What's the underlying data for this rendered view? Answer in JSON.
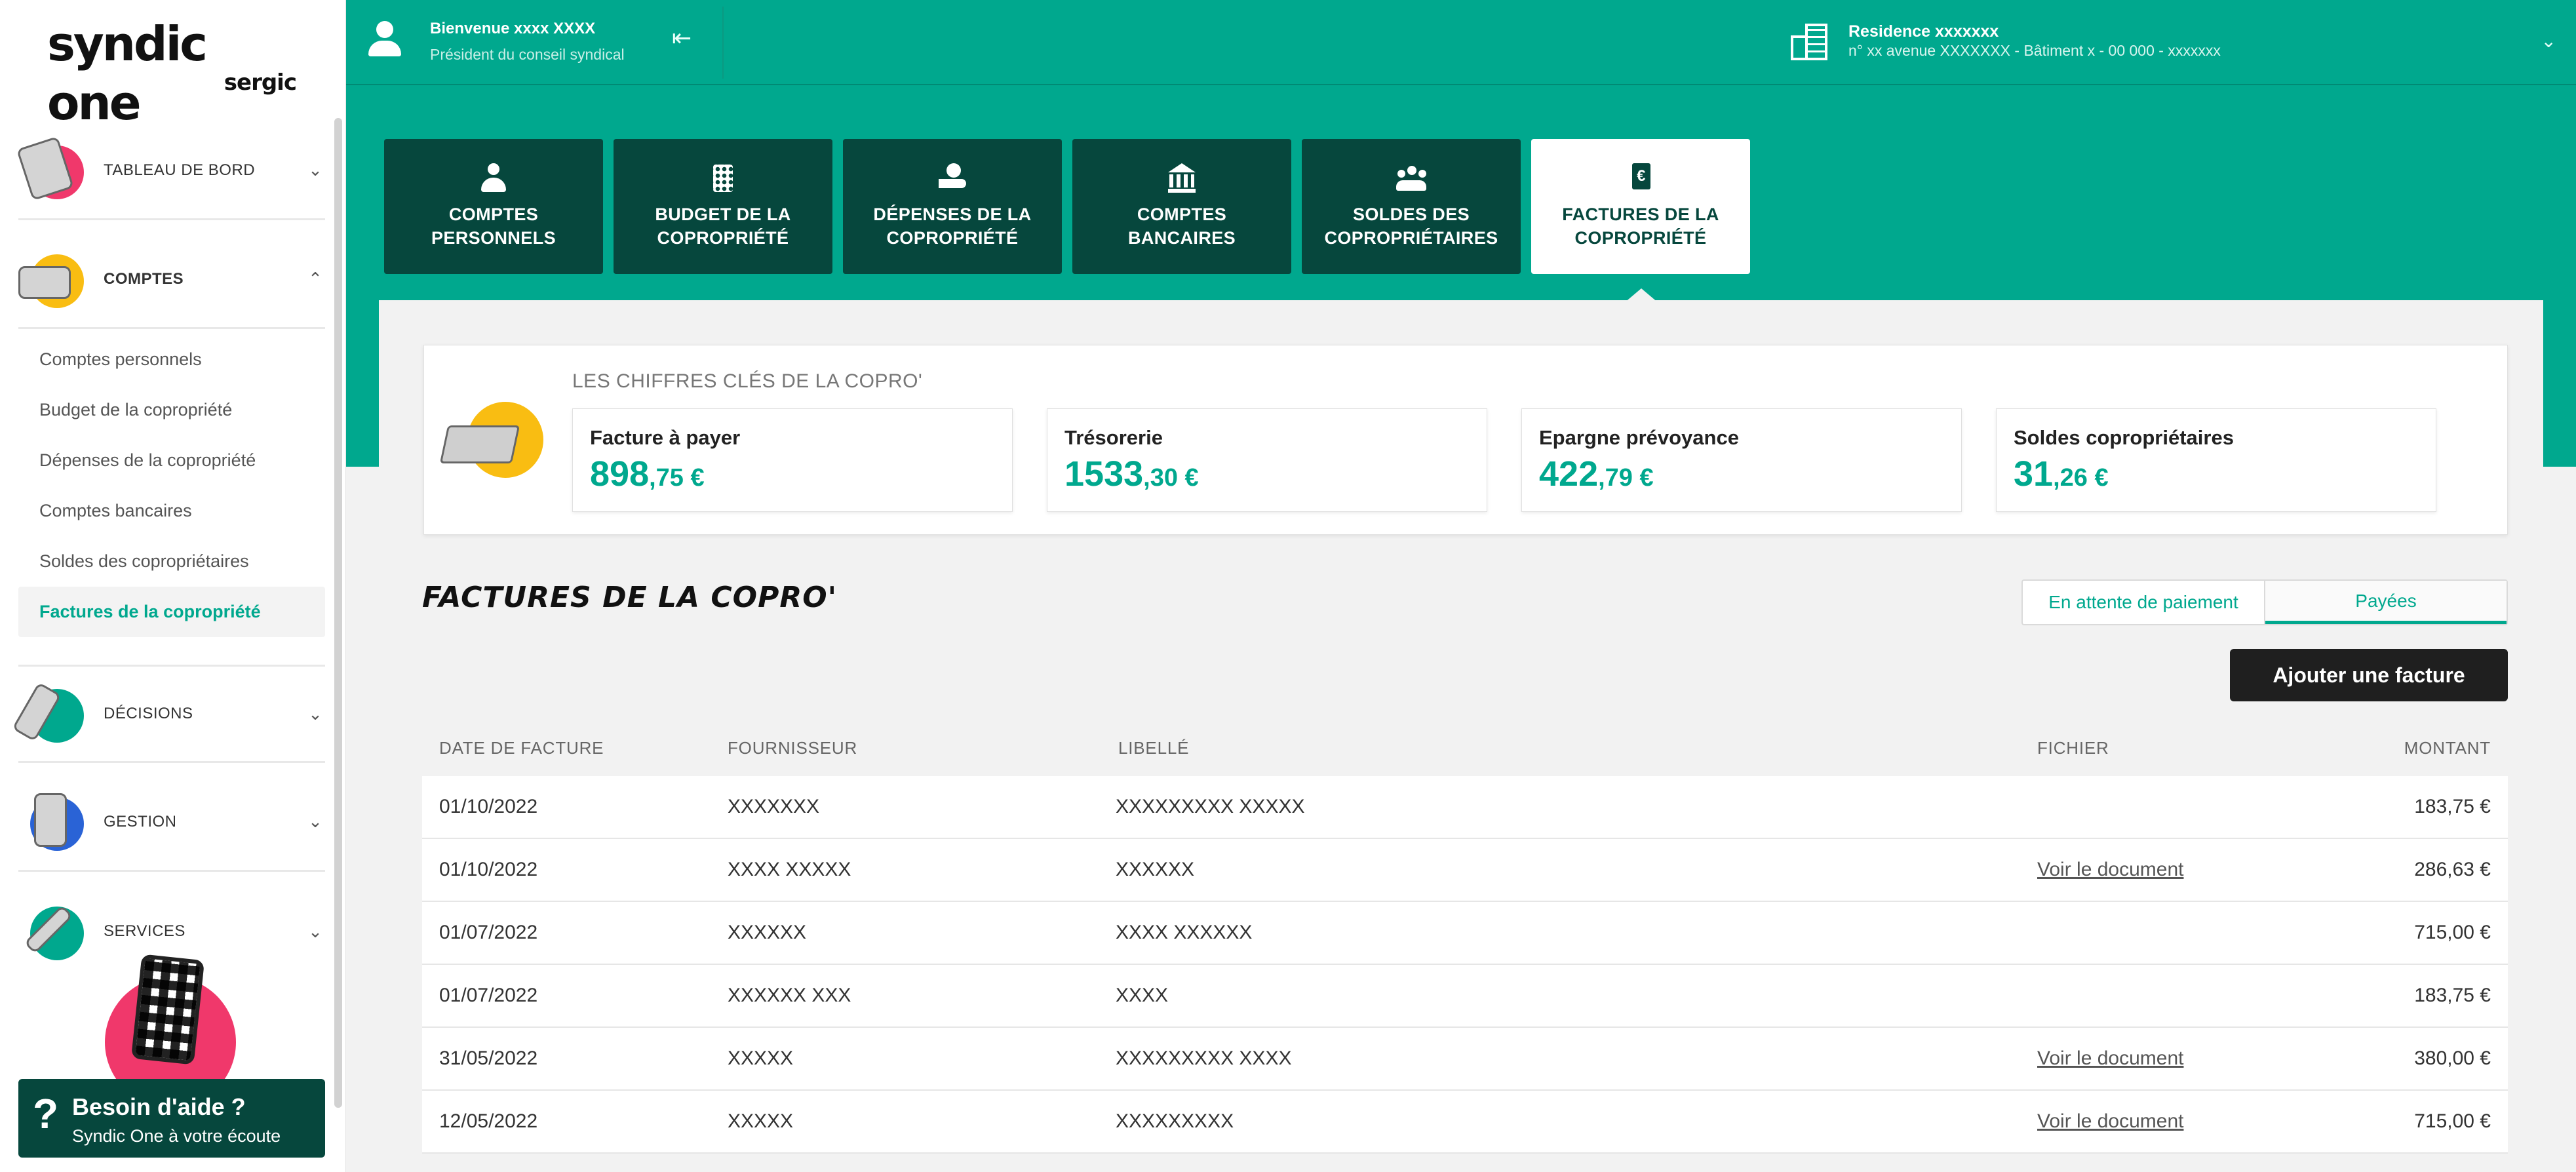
{
  "logo": {
    "main": "syndic one",
    "sub": "sergic"
  },
  "header": {
    "user_name": "Bienvenue xxxx XXXX",
    "user_role": "Président du conseil syndical",
    "residence_name": "Residence xxxxxxx",
    "residence_address": "n° xx avenue XXXXXXX - Bâtiment x - 00 000 - xxxxxxx"
  },
  "sidebar": {
    "sections": [
      {
        "label": "TABLEAU DE BORD",
        "chevron": "⌄"
      },
      {
        "label": "COMPTES",
        "chevron": "⌃"
      },
      {
        "label": "DÉCISIONS",
        "chevron": "⌄"
      },
      {
        "label": "GESTION",
        "chevron": "⌄"
      },
      {
        "label": "SERVICES",
        "chevron": "⌄"
      }
    ],
    "sub_items": [
      "Comptes personnels",
      "Budget de la copropriété",
      "Dépenses de la copropriété",
      "Comptes bancaires",
      "Soldes des copropriétaires",
      "Factures de la copropriété"
    ],
    "help": {
      "icon": "?",
      "title": "Besoin d'aide ?",
      "subtitle": "Syndic One à votre écoute"
    }
  },
  "tabs": [
    {
      "line1": "COMPTES",
      "line2": "PERSONNELS"
    },
    {
      "line1": "BUDGET DE LA",
      "line2": "COPROPRIÉTÉ"
    },
    {
      "line1": "DÉPENSES DE LA",
      "line2": "COPROPRIÉTÉ"
    },
    {
      "line1": "COMPTES",
      "line2": "BANCAIRES"
    },
    {
      "line1": "SOLDES DES",
      "line2": "COPROPRIÉTAIRES"
    },
    {
      "line1": "FACTURES DE LA",
      "line2": "COPROPRIÉTÉ"
    }
  ],
  "kpi": {
    "title": "LES CHIFFRES CLÉS DE LA COPRO'",
    "cards": [
      {
        "label": "Facture à payer",
        "int": "898",
        "dec": ",75 €"
      },
      {
        "label": "Trésorerie",
        "int": "1533",
        "dec": ",30 €"
      },
      {
        "label": "Epargne prévoyance",
        "int": "422",
        "dec": ",79 €"
      },
      {
        "label": "Soldes copropriétaires",
        "int": "31",
        "dec": ",26 €"
      }
    ]
  },
  "invoices": {
    "title": "FACTURES DE LA COPRO'",
    "filter_pending": "En attente de paiement",
    "filter_paid": "Payées",
    "add_button": "Ajouter une facture",
    "columns": [
      "DATE DE FACTURE",
      "FOURNISSEUR",
      "LIBELLÉ",
      "FICHIER",
      "MONTANT"
    ],
    "rows": [
      {
        "date": "01/10/2022",
        "supplier": "XXXXXXX",
        "label": "XXXXXXXXX XXXXX",
        "file": "",
        "amount": "183,75 €"
      },
      {
        "date": "01/10/2022",
        "supplier": "XXXX XXXXX",
        "label": "XXXXXX",
        "file": "Voir le document",
        "amount": "286,63 €"
      },
      {
        "date": "01/07/2022",
        "supplier": "XXXXXX",
        "label": "XXXX XXXXXX",
        "file": "",
        "amount": "715,00 €"
      },
      {
        "date": "01/07/2022",
        "supplier": "XXXXXX XXX",
        "label": "XXXX",
        "file": "",
        "amount": "183,75 €"
      },
      {
        "date": "31/05/2022",
        "supplier": "XXXXX",
        "label": "XXXXXXXXX XXXX",
        "file": "Voir le document",
        "amount": "380,00 €"
      },
      {
        "date": "12/05/2022",
        "supplier": "XXXXX",
        "label": "XXXXXXXXX",
        "file": "Voir le document",
        "amount": "715,00 €"
      }
    ]
  },
  "colors": {
    "brand_green": "#00a88e",
    "dark_green": "#06473d",
    "accent_yellow": "#f9bd12",
    "accent_pink": "#f0386b"
  }
}
